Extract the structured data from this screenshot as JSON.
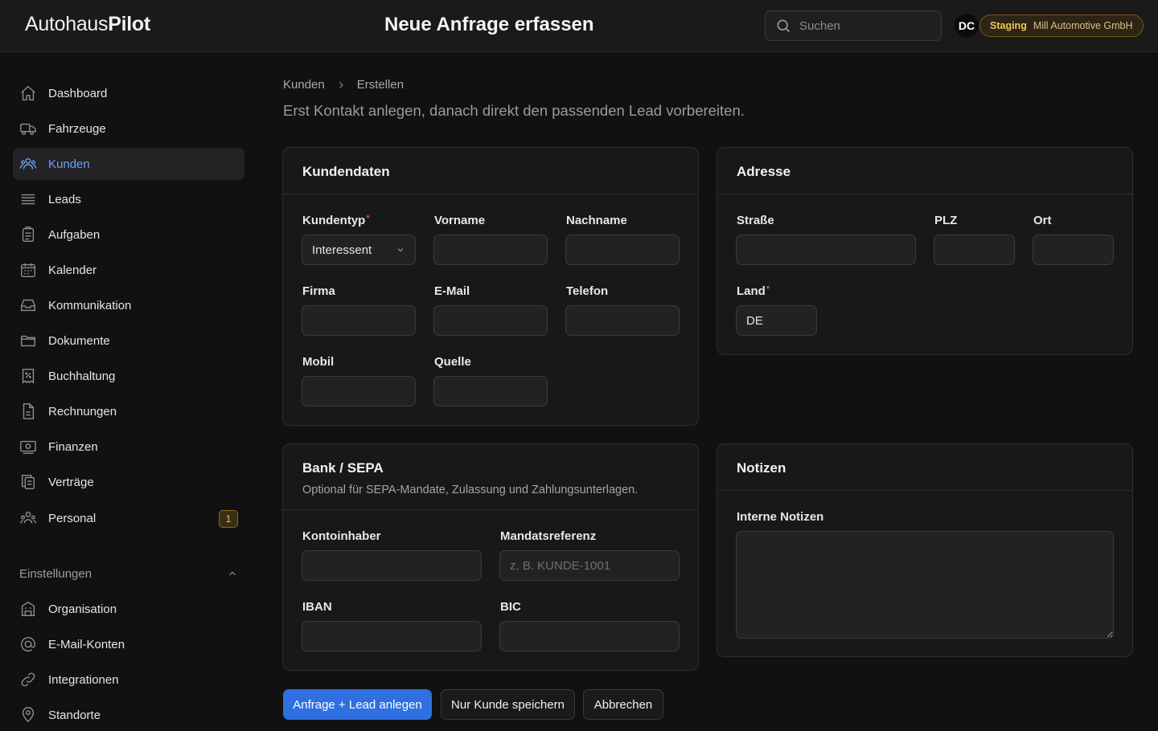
{
  "app": {
    "logo_light": "Autohaus",
    "logo_bold": "Pilot",
    "page_title": "Neue Anfrage erfassen"
  },
  "header": {
    "search_placeholder": "Suchen",
    "avatar_initials": "DC",
    "env_label": "Staging",
    "org_name": "Mill Automotive GmbH"
  },
  "sidebar": {
    "items": [
      {
        "label": "Dashboard",
        "icon": "home-icon"
      },
      {
        "label": "Fahrzeuge",
        "icon": "truck-icon"
      },
      {
        "label": "Kunden",
        "icon": "users-icon",
        "active": true
      },
      {
        "label": "Leads",
        "icon": "stack-icon"
      },
      {
        "label": "Aufgaben",
        "icon": "clipboard-icon"
      },
      {
        "label": "Kalender",
        "icon": "calendar-icon"
      },
      {
        "label": "Kommunikation",
        "icon": "inbox-icon"
      },
      {
        "label": "Dokumente",
        "icon": "folder-icon"
      },
      {
        "label": "Buchhaltung",
        "icon": "receipt-percent-icon"
      },
      {
        "label": "Rechnungen",
        "icon": "document-icon"
      },
      {
        "label": "Finanzen",
        "icon": "banknote-icon"
      },
      {
        "label": "Verträge",
        "icon": "documents-copy-icon"
      },
      {
        "label": "Personal",
        "icon": "team-icon",
        "badge": "1"
      }
    ],
    "settings_label": "Einstellungen",
    "settings_items": [
      {
        "label": "Organisation",
        "icon": "building-icon"
      },
      {
        "label": "E-Mail-Konten",
        "icon": "at-icon"
      },
      {
        "label": "Integrationen",
        "icon": "link-icon"
      },
      {
        "label": "Standorte",
        "icon": "map-pin-icon"
      }
    ]
  },
  "breadcrumb": {
    "parent": "Kunden",
    "current": "Erstellen"
  },
  "subtitle": "Erst Kontakt anlegen, danach direkt den passenden Lead vorbereiten.",
  "kundendaten": {
    "title": "Kundendaten",
    "kundentyp_label": "Kundentyp",
    "kundentyp_value": "Interessent",
    "vorname_label": "Vorname",
    "vorname_value": "",
    "nachname_label": "Nachname",
    "nachname_value": "",
    "firma_label": "Firma",
    "firma_value": "",
    "email_label": "E-Mail",
    "email_value": "",
    "telefon_label": "Telefon",
    "telefon_value": "",
    "mobil_label": "Mobil",
    "mobil_value": "",
    "quelle_label": "Quelle",
    "quelle_value": ""
  },
  "adresse": {
    "title": "Adresse",
    "strasse_label": "Straße",
    "strasse_value": "",
    "plz_label": "PLZ",
    "plz_value": "",
    "ort_label": "Ort",
    "ort_value": "",
    "land_label": "Land",
    "land_value": "DE"
  },
  "bank": {
    "title": "Bank / SEPA",
    "description": "Optional für SEPA-Mandate, Zulassung und Zahlungsunterlagen.",
    "kontoinhaber_label": "Kontoinhaber",
    "kontoinhaber_value": "",
    "mandat_label": "Mandatsreferenz",
    "mandat_placeholder": "z. B. KUNDE-1001",
    "iban_label": "IBAN",
    "iban_value": "",
    "bic_label": "BIC",
    "bic_value": ""
  },
  "notizen": {
    "title": "Notizen",
    "interne_label": "Interne Notizen",
    "interne_value": ""
  },
  "actions": {
    "primary": "Anfrage + Lead anlegen",
    "save_only": "Nur Kunde speichern",
    "cancel": "Abbrechen"
  },
  "colors": {
    "accent": "#2f6fe0",
    "active_nav": "#6e9ff5",
    "required": "#e04848",
    "staging": "#f0c35a"
  }
}
